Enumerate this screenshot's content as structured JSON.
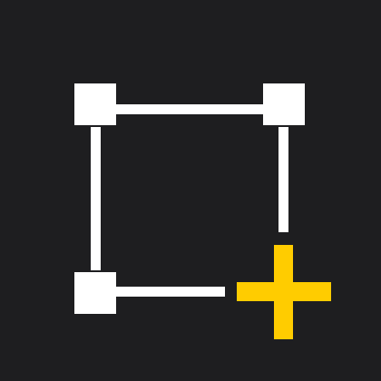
{
  "icon": {
    "name": "add-selection-box-icon",
    "description_visible_text": ""
  },
  "colors": {
    "background": "#1e1e20",
    "frame": "#ffffff",
    "plus": "#ffcc00"
  }
}
